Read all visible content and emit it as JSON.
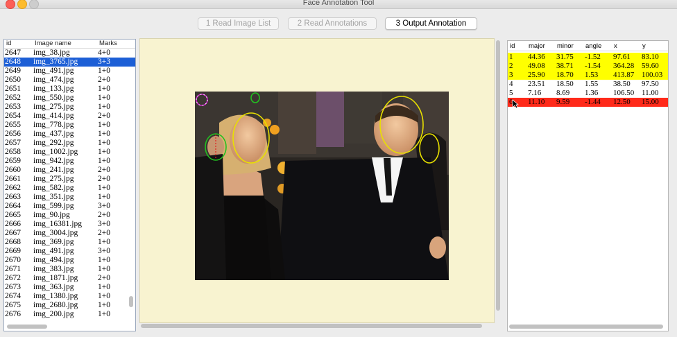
{
  "window": {
    "title": "Face Annotation Tool"
  },
  "toolbar": {
    "tabs": [
      {
        "label": "1 Read Image List"
      },
      {
        "label": "2 Read Annotations"
      },
      {
        "label": "3 Output Annotation"
      }
    ]
  },
  "image_list": {
    "columns": {
      "id": "id",
      "name": "Image name",
      "marks": "Marks"
    },
    "rows": [
      {
        "id": "2647",
        "name": "img_38.jpg",
        "marks": "4+0"
      },
      {
        "id": "2648",
        "name": "img_3765.jpg",
        "marks": "3+3"
      },
      {
        "id": "2649",
        "name": "img_491.jpg",
        "marks": "1+0"
      },
      {
        "id": "2650",
        "name": "img_474.jpg",
        "marks": "2+0"
      },
      {
        "id": "2651",
        "name": "img_133.jpg",
        "marks": "1+0"
      },
      {
        "id": "2652",
        "name": "img_550.jpg",
        "marks": "1+0"
      },
      {
        "id": "2653",
        "name": "img_275.jpg",
        "marks": "1+0"
      },
      {
        "id": "2654",
        "name": "img_414.jpg",
        "marks": "2+0"
      },
      {
        "id": "2655",
        "name": "img_778.jpg",
        "marks": "1+0"
      },
      {
        "id": "2656",
        "name": "img_437.jpg",
        "marks": "1+0"
      },
      {
        "id": "2657",
        "name": "img_292.jpg",
        "marks": "1+0"
      },
      {
        "id": "2658",
        "name": "img_1002.jpg",
        "marks": "1+0"
      },
      {
        "id": "2659",
        "name": "img_942.jpg",
        "marks": "1+0"
      },
      {
        "id": "2660",
        "name": "img_241.jpg",
        "marks": "2+0"
      },
      {
        "id": "2661",
        "name": "img_275.jpg",
        "marks": "2+0"
      },
      {
        "id": "2662",
        "name": "img_582.jpg",
        "marks": "1+0"
      },
      {
        "id": "2663",
        "name": "img_351.jpg",
        "marks": "1+0"
      },
      {
        "id": "2664",
        "name": "img_599.jpg",
        "marks": "3+0"
      },
      {
        "id": "2665",
        "name": "img_90.jpg",
        "marks": "2+0"
      },
      {
        "id": "2666",
        "name": "img_16381.jpg",
        "marks": "3+0"
      },
      {
        "id": "2667",
        "name": "img_3004.jpg",
        "marks": "2+0"
      },
      {
        "id": "2668",
        "name": "img_369.jpg",
        "marks": "1+0"
      },
      {
        "id": "2669",
        "name": "img_491.jpg",
        "marks": "3+0"
      },
      {
        "id": "2670",
        "name": "img_494.jpg",
        "marks": "1+0"
      },
      {
        "id": "2671",
        "name": "img_383.jpg",
        "marks": "1+0"
      },
      {
        "id": "2672",
        "name": "img_1871.jpg",
        "marks": "2+0"
      },
      {
        "id": "2673",
        "name": "img_363.jpg",
        "marks": "1+0"
      },
      {
        "id": "2674",
        "name": "img_1380.jpg",
        "marks": "1+0"
      },
      {
        "id": "2675",
        "name": "img_2680.jpg",
        "marks": "1+0"
      },
      {
        "id": "2676",
        "name": "img_200.jpg",
        "marks": "1+0"
      }
    ],
    "selected_index": 1
  },
  "annotations": {
    "columns": [
      "id",
      "major",
      "minor",
      "angle",
      "x",
      "y"
    ],
    "rows": [
      {
        "cells": [
          "1",
          "44.36",
          "31.75",
          "-1.52",
          "97.61",
          "83.10"
        ],
        "status": "highlight"
      },
      {
        "cells": [
          "2",
          "49.08",
          "38.71",
          "-1.54",
          "364.28",
          "59.60"
        ],
        "status": "highlight"
      },
      {
        "cells": [
          "3",
          "25.90",
          "18.70",
          "1.53",
          "413.87",
          "100.03"
        ],
        "status": "highlight"
      },
      {
        "cells": [
          "4",
          "23.51",
          "18.50",
          "1.55",
          "38.50",
          "97.50"
        ],
        "status": "normal"
      },
      {
        "cells": [
          "5",
          "7.16",
          "8.69",
          "1.36",
          "106.50",
          "11.00"
        ],
        "status": "normal"
      },
      {
        "cells": [
          "6",
          "11.10",
          "9.59",
          "-1.44",
          "12.50",
          "15.00"
        ],
        "status": "selected"
      }
    ]
  },
  "colors": {
    "highlight": "#ffff00",
    "selected": "#ff2a1a",
    "list_selection": "#1d5fd6",
    "ellipse_yellow": "#e8e000",
    "ellipse_green": "#22c020",
    "ellipse_magenta": "#d020d0"
  }
}
